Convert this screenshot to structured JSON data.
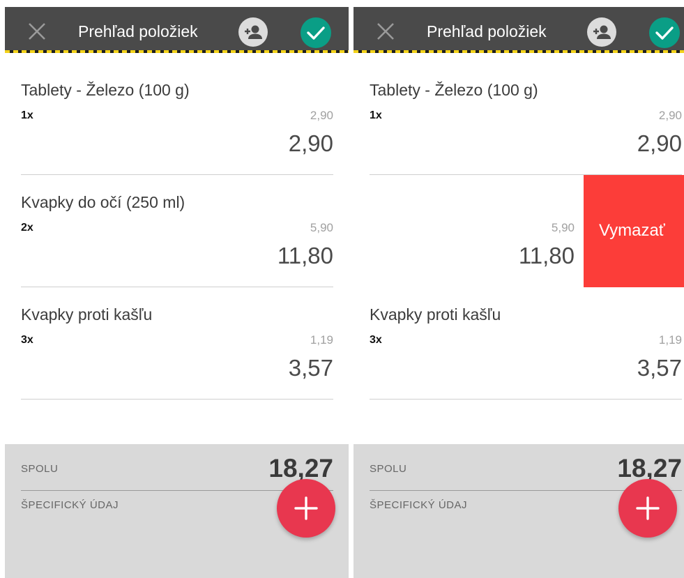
{
  "header": {
    "title": "Prehľad položiek",
    "close_icon": "close-icon",
    "add_user_icon": "add-person-icon",
    "confirm_icon": "checkmark-icon"
  },
  "items": [
    {
      "name": "Tablety - Železo (100 g)",
      "qty": "1x",
      "unit_price": "2,90",
      "total": "2,90"
    },
    {
      "name": "Kvapky do očí (250 ml)",
      "qty": "2x",
      "unit_price": "5,90",
      "total": "11,80"
    },
    {
      "name": "Kvapky proti kašľu",
      "qty": "3x",
      "unit_price": "1,19",
      "total": "3,57"
    }
  ],
  "swipe_action": {
    "label": "Vymazať",
    "color": "#fc3d39"
  },
  "footer": {
    "total_label": "SPOLU",
    "total_value": "18,27",
    "specific_label": "ŠPECIFICKÝ ÚDAJ",
    "fab_icon": "plus-icon"
  },
  "colors": {
    "header_bg": "#4a4a4a",
    "confirm": "#0a9e86",
    "fab": "#e8374f",
    "footer_bg": "#d9d9d9"
  }
}
